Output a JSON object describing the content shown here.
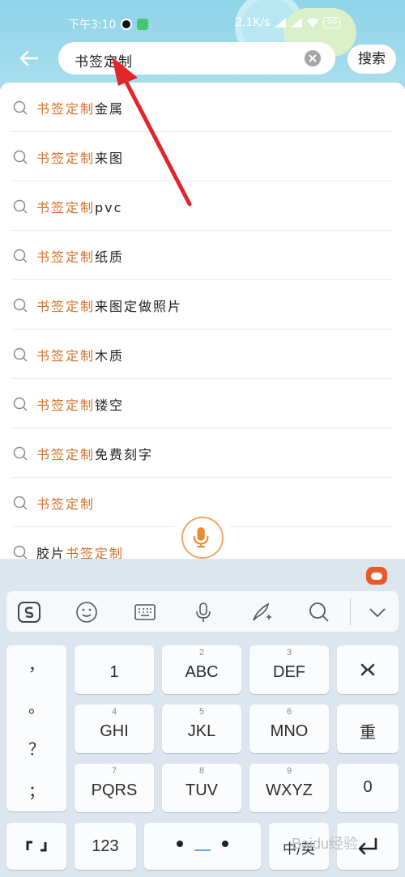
{
  "status_bar": {
    "time": "下午3:10",
    "net_speed": "2.1K/s",
    "battery": "90"
  },
  "search": {
    "query": "书签定制",
    "search_button_label": "搜索"
  },
  "suggestions": [
    {
      "prefix": "",
      "highlight": "书签定制",
      "suffix": "金属"
    },
    {
      "prefix": "",
      "highlight": "书签定制",
      "suffix": "来图"
    },
    {
      "prefix": "",
      "highlight": "书签定制",
      "suffix": "pvc"
    },
    {
      "prefix": "",
      "highlight": "书签定制",
      "suffix": "纸质"
    },
    {
      "prefix": "",
      "highlight": "书签定制",
      "suffix": "来图定做照片"
    },
    {
      "prefix": "",
      "highlight": "书签定制",
      "suffix": "木质"
    },
    {
      "prefix": "",
      "highlight": "书签定制",
      "suffix": "镂空"
    },
    {
      "prefix": "",
      "highlight": "书签定制",
      "suffix": "免费刻字"
    },
    {
      "prefix": "",
      "highlight": "书签定制",
      "suffix": ""
    },
    {
      "prefix": "胶片",
      "highlight": "书签定制",
      "suffix": ""
    }
  ],
  "keyboard": {
    "toolbar_icons": [
      "sogou-logo-icon",
      "emoji-icon",
      "keyboard-icon",
      "microphone-icon",
      "handwriting-icon",
      "search-icon",
      "chevron-down-icon"
    ],
    "punctuation": [
      "，",
      "。",
      "？",
      "；"
    ],
    "keys": {
      "k1": {
        "main": "1",
        "sub": ""
      },
      "k2": {
        "main": "ABC",
        "sub": "2"
      },
      "k3": {
        "main": "DEF",
        "sub": "3"
      },
      "k4": {
        "main": "GHI",
        "sub": "4"
      },
      "k5": {
        "main": "JKL",
        "sub": "5"
      },
      "k6": {
        "main": "MNO",
        "sub": "6"
      },
      "k7": {
        "main": "PQRS",
        "sub": "7"
      },
      "k8": {
        "main": "TUV",
        "sub": "8"
      },
      "k9": {
        "main": "WXYZ",
        "sub": "9"
      },
      "k0": {
        "main": "0",
        "sub": ""
      }
    },
    "reenter_label": "重",
    "num_label": "123",
    "lang_label": "中/英"
  },
  "watermark": "Baidu经验",
  "colors": {
    "highlight": "#d4732e",
    "header_bg": "#a9dfee",
    "arrow": "#e0252b",
    "keyboard_bg": "#dde6ee"
  }
}
